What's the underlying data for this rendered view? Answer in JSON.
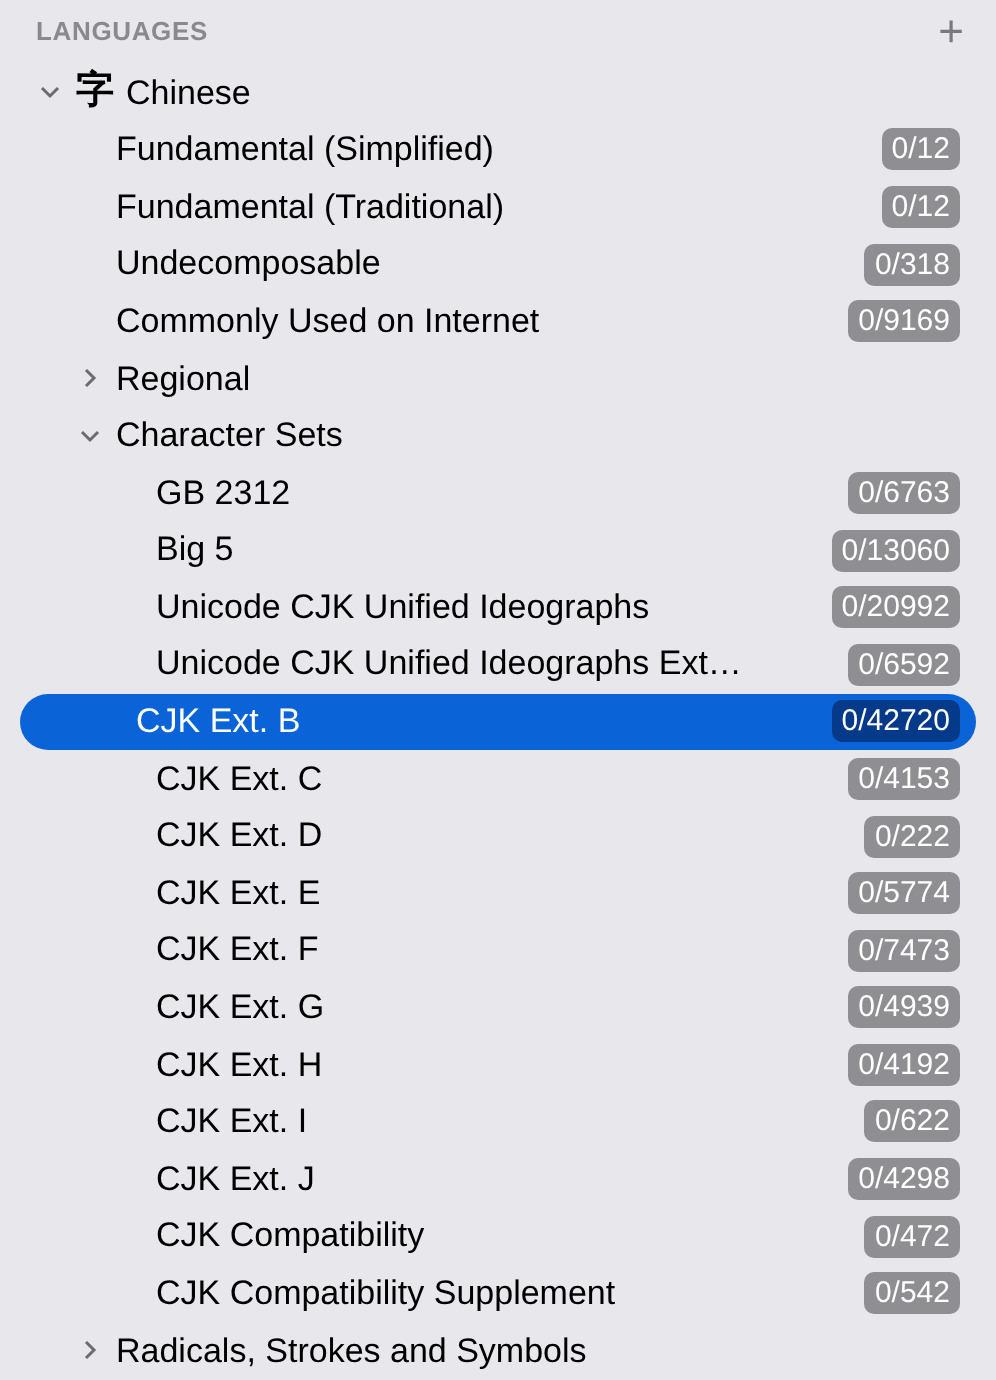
{
  "section": {
    "title": "LANGUAGES",
    "add_button": "+"
  },
  "tree": [
    {
      "label": "Chinese",
      "glyph": "字",
      "expanded": true,
      "selected": false,
      "children": [
        {
          "label": "Fundamental (Simplified)",
          "count": "0/12",
          "selected": false
        },
        {
          "label": "Fundamental (Traditional)",
          "count": "0/12",
          "selected": false
        },
        {
          "label": "Undecomposable",
          "count": "0/318",
          "selected": false
        },
        {
          "label": "Commonly Used on Internet",
          "count": "0/9169",
          "selected": false
        },
        {
          "label": "Regional",
          "expanded": false,
          "selected": false
        },
        {
          "label": "Character Sets",
          "expanded": true,
          "selected": false,
          "children": [
            {
              "label": "GB 2312",
              "count": "0/6763",
              "selected": false
            },
            {
              "label": "Big 5",
              "count": "0/13060",
              "selected": false
            },
            {
              "label": "Unicode CJK Unified Ideographs",
              "count": "0/20992",
              "selected": false
            },
            {
              "label": "Unicode CJK Unified Ideographs Ext…",
              "count": "0/6592",
              "selected": false
            },
            {
              "label": "CJK Ext. B",
              "count": "0/42720",
              "selected": true
            },
            {
              "label": "CJK Ext. C",
              "count": "0/4153",
              "selected": false
            },
            {
              "label": "CJK Ext. D",
              "count": "0/222",
              "selected": false
            },
            {
              "label": "CJK Ext. E",
              "count": "0/5774",
              "selected": false
            },
            {
              "label": "CJK Ext. F",
              "count": "0/7473",
              "selected": false
            },
            {
              "label": "CJK Ext. G",
              "count": "0/4939",
              "selected": false
            },
            {
              "label": "CJK Ext. H",
              "count": "0/4192",
              "selected": false
            },
            {
              "label": "CJK Ext. I",
              "count": "0/622",
              "selected": false
            },
            {
              "label": "CJK Ext. J",
              "count": "0/4298",
              "selected": false
            },
            {
              "label": "CJK Compatibility",
              "count": "0/472",
              "selected": false
            },
            {
              "label": "CJK Compatibility Supplement",
              "count": "0/542",
              "selected": false
            }
          ]
        },
        {
          "label": "Radicals, Strokes and Symbols",
          "expanded": false,
          "selected": false
        }
      ]
    }
  ]
}
